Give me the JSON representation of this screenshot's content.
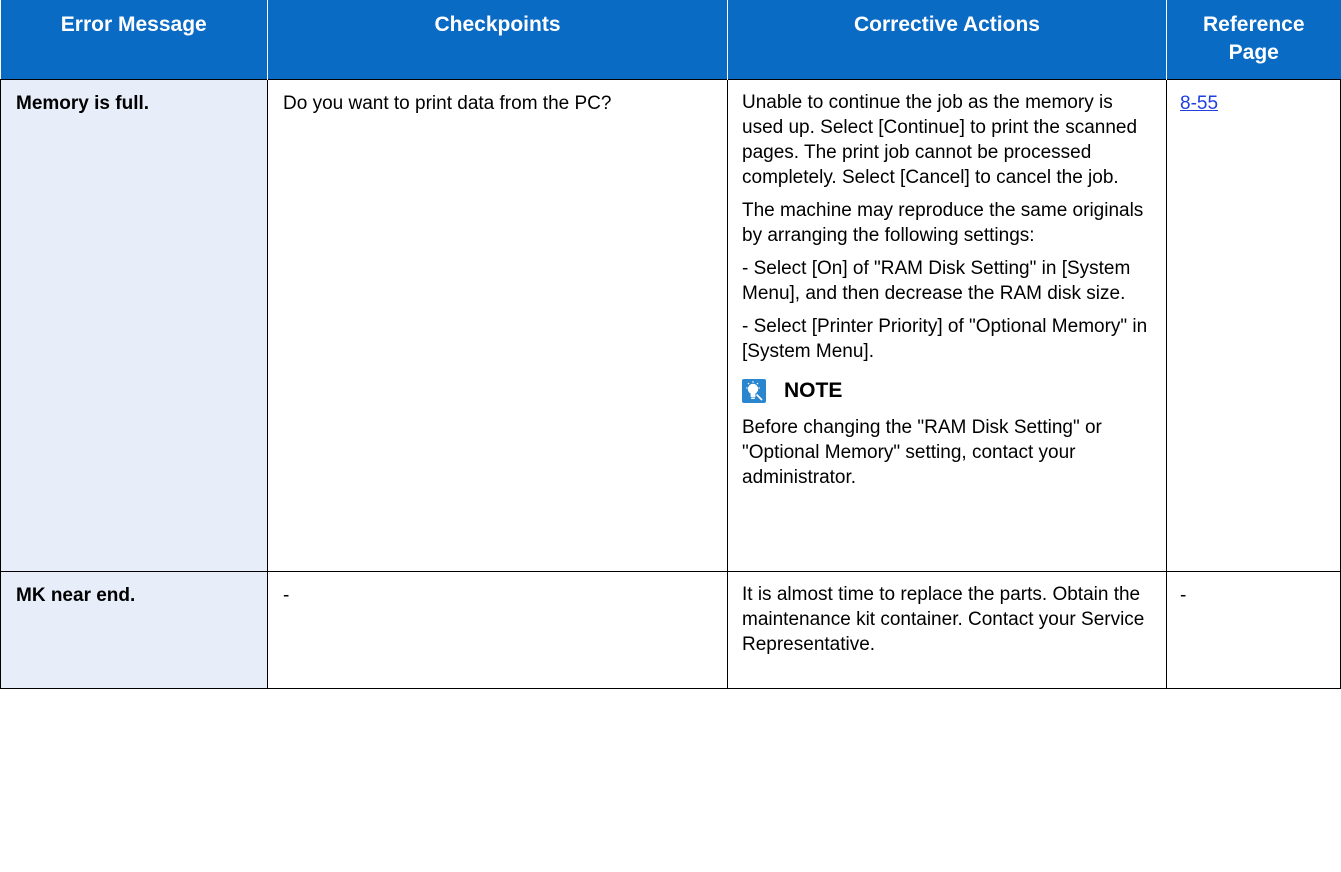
{
  "headers": {
    "error_message": "Error Message",
    "checkpoints": "Checkpoints",
    "corrective_actions": "Corrective Actions",
    "reference_page_line1": "Reference",
    "reference_page_line2": "Page"
  },
  "rows": [
    {
      "message": "Memory is full.",
      "checkpoint": "Do you want to print data from the PC?",
      "actions": [
        "Unable to continue the job as the memory is used up. Select [Continue] to print the scanned pages. The print job cannot be processed completely. Select [Cancel] to cancel the job.",
        "The machine may reproduce the same originals by arranging the following settings:",
        "- Select [On] of \"RAM Disk Setting\" in [System Menu], and then decrease the RAM disk size.",
        "- Select [Printer Priority] of \"Optional Memory\" in [System Menu]."
      ],
      "note_label": "NOTE",
      "note_text": "Before changing the \"RAM Disk Setting\" or \"Optional Memory\" setting, contact your administrator.",
      "reference": "8-55"
    },
    {
      "message": "MK near end.",
      "checkpoint": "-",
      "actions": [
        "It is almost time to replace the parts. Obtain the maintenance kit container. Contact your Service Representative."
      ],
      "reference": "-"
    }
  ],
  "colors": {
    "header_bg": "#0a6bc4",
    "message_cell_bg": "#e7eefa",
    "link": "#1f3fe0",
    "note_icon": "#2a86cf"
  },
  "icons": {
    "note": "lightbulb-note-icon"
  }
}
